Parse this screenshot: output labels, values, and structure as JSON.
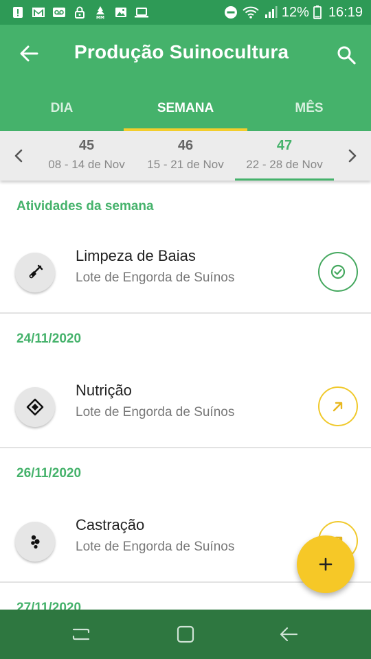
{
  "status_bar": {
    "battery": "12%",
    "time": "16:19",
    "left_icons": [
      "alert-icon",
      "gmail-icon",
      "voicemail-icon",
      "lock-icon",
      "mm-icon",
      "image-icon",
      "laptop-icon"
    ],
    "right_icons": [
      "do-not-disturb-icon",
      "wifi-icon",
      "signal-icon",
      "battery-icon"
    ]
  },
  "app_bar": {
    "title": "Produção Suinocultura",
    "color": "#45b26b"
  },
  "tabs": [
    {
      "label": "DIA",
      "active": false
    },
    {
      "label": "SEMANA",
      "active": true
    },
    {
      "label": "MÊS",
      "active": false
    }
  ],
  "weeks": [
    {
      "number": "45",
      "range": "08 - 14 de Nov",
      "active": false
    },
    {
      "number": "46",
      "range": "15 - 21 de Nov",
      "active": false
    },
    {
      "number": "47",
      "range": "22 - 28 de Nov",
      "active": true
    }
  ],
  "sections": [
    {
      "title": "Atividades da semana",
      "items": [
        {
          "title": "Limpeza de Baias",
          "subtitle": "Lote de Engorda de Suínos",
          "icon": "shovel-icon",
          "status": "done"
        }
      ]
    },
    {
      "title": "24/11/2020",
      "items": [
        {
          "title": "Nutrição",
          "subtitle": "Lote de Engorda de Suínos",
          "icon": "feed-icon",
          "status": "pending"
        }
      ]
    },
    {
      "title": "26/11/2020",
      "items": [
        {
          "title": "Castração",
          "subtitle": "Lote de Engorda de Suínos",
          "icon": "castration-icon",
          "status": "pending"
        }
      ]
    },
    {
      "title": "27/11/2020",
      "items": []
    }
  ],
  "colors": {
    "primary": "#45b26b",
    "status_bar": "#2e9a56",
    "nav_bar": "#2e7740",
    "accent": "#f3ce2c",
    "done": "#45a85f",
    "pending": "#f0c92c"
  }
}
